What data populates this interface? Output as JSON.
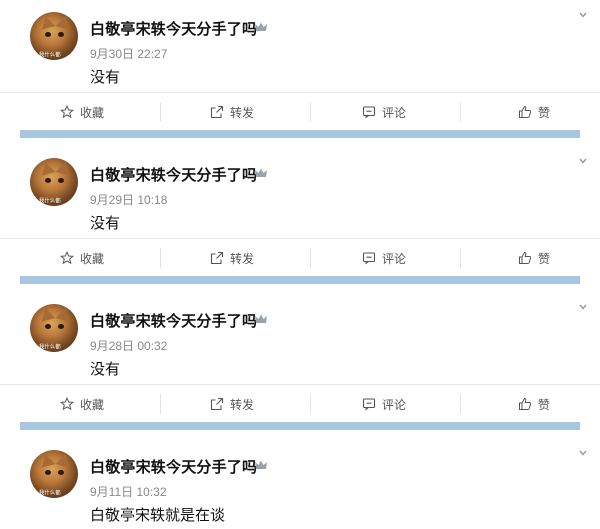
{
  "posts": [
    {
      "username": "白敬亭宋轶今天分手了吗",
      "timestamp": "9月30日 22:27",
      "content": "没有",
      "avatar_tag": "我什么都"
    },
    {
      "username": "白敬亭宋轶今天分手了吗",
      "timestamp": "9月29日 10:18",
      "content": "没有",
      "avatar_tag": "我什么都"
    },
    {
      "username": "白敬亭宋轶今天分手了吗",
      "timestamp": "9月28日 00:32",
      "content": "没有",
      "avatar_tag": "我什么都"
    },
    {
      "username": "白敬亭宋轶今天分手了吗",
      "timestamp": "9月11日 10:32",
      "content": "白敬亭宋轶就是在谈",
      "avatar_tag": "我什么都"
    }
  ],
  "actions": {
    "favorite": "收藏",
    "repost": "转发",
    "comment": "评论",
    "like": "赞"
  },
  "icons": {
    "favorite": "star-icon",
    "repost": "share-icon",
    "comment": "comment-icon",
    "like": "thumbs-up-icon",
    "badge": "crown-icon",
    "menu": "chevron-down-icon"
  },
  "colors": {
    "separator": "#a9c6e0",
    "timestamp": "#888888",
    "action_text": "#555555"
  }
}
